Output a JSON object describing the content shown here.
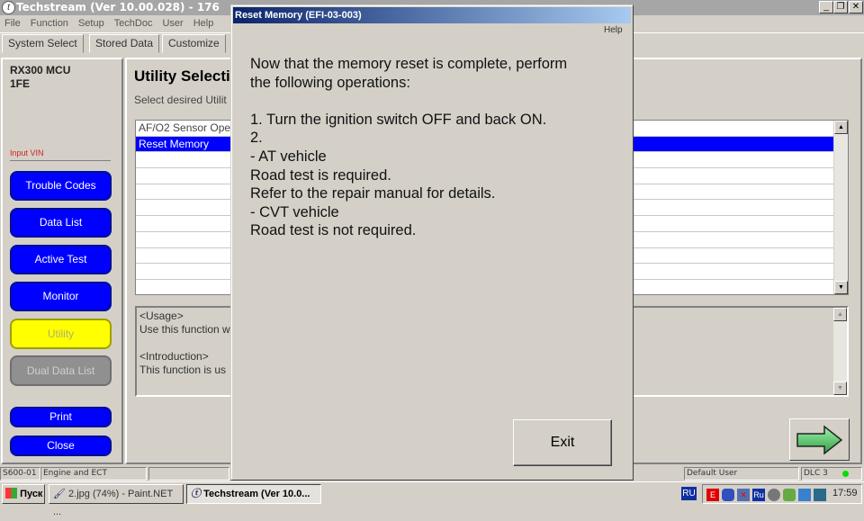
{
  "window": {
    "title": "Techstream (Ver 10.00.028) - 176",
    "icon": "techstream-logo-icon"
  },
  "menu": [
    "File",
    "Function",
    "Setup",
    "TechDoc",
    "User",
    "Help"
  ],
  "tabs": [
    "System Select",
    "Stored Data",
    "Customize"
  ],
  "vehicle": {
    "model": "RX300 MCU",
    "engine": "1FE",
    "input_vin": "Input VIN"
  },
  "sidebar": {
    "buttons": [
      "Trouble Codes",
      "Data List",
      "Active Test",
      "Monitor",
      "Utility",
      "Dual Data List",
      "Print",
      "Close"
    ],
    "active": "Utility",
    "active_color": "#ffff00",
    "button_color": "#0000ff"
  },
  "main": {
    "title": "Utility Selecti",
    "subtitle": "Select desired Utilit",
    "list": [
      "AF/O2 Sensor Ope",
      "Reset Memory"
    ],
    "selected": "Reset Memory",
    "info": [
      "<Usage>",
      "Use this function w",
      "",
      "<Introduction>",
      "This function is us"
    ]
  },
  "dialog": {
    "title": "Reset Memory (EFI-03-003)",
    "help": "Help",
    "lines": [
      "Now that the memory reset is complete, perform",
      "the following operations:",
      "",
      "1. Turn the ignition switch OFF and back ON.",
      "2.",
      "- AT vehicle",
      "Road test is required.",
      "Refer to the repair manual for details.",
      "- CVT vehicle",
      "Road test is not required."
    ],
    "exit": "Exit"
  },
  "statusbar": {
    "code": "S600-01",
    "system": "Engine and ECT",
    "user": "Default User",
    "dlc": "DLC 3",
    "connection_color": "#00e000"
  },
  "taskbar": {
    "start": "Пуск",
    "items": [
      "2.jpg (74%) - Paint.NET ...",
      "Techstream (Ver 10.0..."
    ],
    "lang": "RU",
    "clock": "17:59"
  }
}
